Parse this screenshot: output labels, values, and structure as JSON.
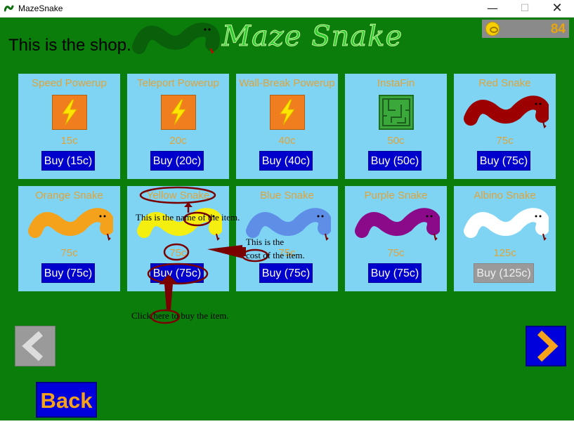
{
  "window": {
    "title": "MazeSnake",
    "minimize": "—",
    "maximize": "☐",
    "close": "✕"
  },
  "header": {
    "shop_text": "This is the shop.",
    "logo_text": "Maze Snake",
    "coins": "84"
  },
  "items": [
    {
      "name": "Speed Powerup",
      "cost": "15c",
      "buy": "Buy (15c)",
      "icon": "lightning-icon"
    },
    {
      "name": "Teleport Powerup",
      "cost": "20c",
      "buy": "Buy (20c)",
      "icon": "lightning-icon"
    },
    {
      "name": "Wall-Break Powerup",
      "cost": "40c",
      "buy": "Buy (40c)",
      "icon": "lightning-icon"
    },
    {
      "name": "InstaFin",
      "cost": "50c",
      "buy": "Buy (50c)",
      "icon": "maze-icon"
    },
    {
      "name": "Red Snake",
      "cost": "75c",
      "buy": "Buy (75c)",
      "icon": "snake-icon",
      "color": "#9c0000"
    },
    {
      "name": "Orange Snake",
      "cost": "75c",
      "buy": "Buy (75c)",
      "icon": "snake-icon",
      "color": "#f4a21c"
    },
    {
      "name": "Yellow Snake",
      "cost": "75c",
      "buy": "Buy (75c)",
      "icon": "snake-icon",
      "color": "#f5ef10"
    },
    {
      "name": "Blue Snake",
      "cost": "75c",
      "buy": "Buy (75c)",
      "icon": "snake-icon",
      "color": "#5e8ee6"
    },
    {
      "name": "Purple Snake",
      "cost": "75c",
      "buy": "Buy (75c)",
      "icon": "snake-icon",
      "color": "#8a0a8a"
    },
    {
      "name": "Albino Snake",
      "cost": "125c",
      "buy": "Buy (125c)",
      "icon": "snake-icon",
      "color": "#ffffff",
      "buy_disabled": true
    }
  ],
  "annotations": {
    "name_note": "This is the name of the item.",
    "cost_note_line1": "This is the",
    "cost_note_line2": "cost of the item.",
    "buy_note": "Click here to buy the item."
  },
  "nav": {
    "back": "Back",
    "prev_icon": "chevron-left-icon",
    "next_icon": "chevron-right-icon"
  },
  "colors": {
    "background": "#0b7d0b",
    "card": "#7fd4f4",
    "button": "#0000cc",
    "label": "#e0a33a",
    "annotation": "#7a0000"
  }
}
